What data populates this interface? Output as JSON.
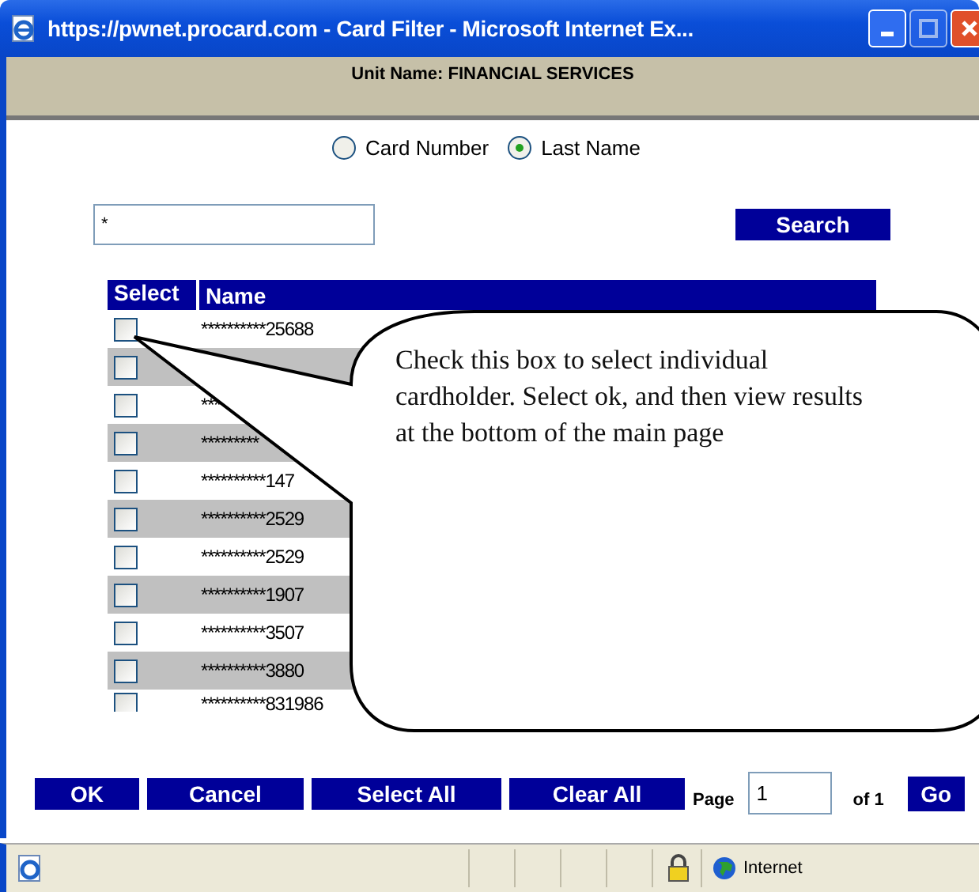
{
  "window": {
    "title": "https://pwnet.procard.com - Card Filter - Microsoft Internet Ex..."
  },
  "unit_name": "Unit Name: FINANCIAL SERVICES",
  "search_by": [
    {
      "label": "Card Number",
      "selected": false
    },
    {
      "label": "Last Name",
      "selected": true
    }
  ],
  "search": {
    "value": "*",
    "button": "Search"
  },
  "table": {
    "columns": [
      "Select",
      "Name"
    ],
    "rows": [
      {
        "name": "**********25688",
        "checked": false
      },
      {
        "name": "",
        "checked": false
      },
      {
        "name": "***",
        "checked": false
      },
      {
        "name": "*********",
        "checked": false
      },
      {
        "name": "**********147",
        "checked": false
      },
      {
        "name": "**********2529",
        "checked": false
      },
      {
        "name": "**********2529",
        "checked": false
      },
      {
        "name": "**********1907",
        "checked": false
      },
      {
        "name": "**********3507",
        "checked": false
      },
      {
        "name": "**********3880",
        "checked": false
      },
      {
        "name": "**********831986",
        "checked": false
      }
    ]
  },
  "callout": "Check this box to select individual cardholder. Select ok, and then view results at the bottom of the main page",
  "buttons": [
    "OK",
    "Cancel",
    "Select All",
    "Clear All"
  ],
  "pager": {
    "label": "Page",
    "value": "1",
    "of": "of 1",
    "go": "Go"
  },
  "status_bar": {
    "zone": "Internet"
  }
}
